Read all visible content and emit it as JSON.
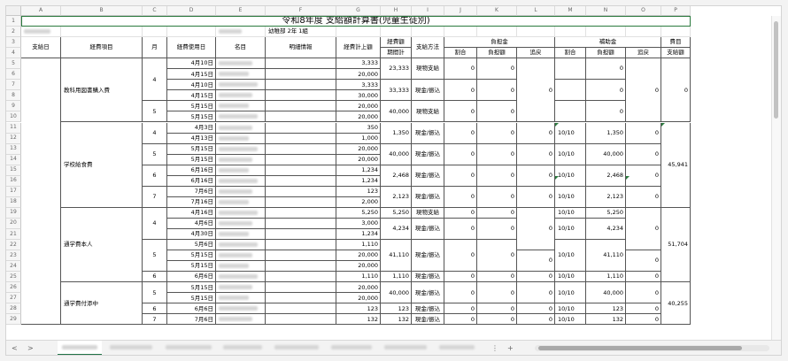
{
  "sheet": {
    "title": "令和8年度 支給額計算書(児童生徒別)",
    "school_label": "幼稚部 2年 1組",
    "columns": [
      "A",
      "B",
      "C",
      "D",
      "E",
      "F",
      "G",
      "H",
      "I",
      "J",
      "K",
      "L",
      "M",
      "N",
      "O",
      "P"
    ],
    "row_numbers": [
      "1",
      "2",
      "3",
      "4",
      "5",
      "6",
      "7",
      "8",
      "9",
      "10",
      "11",
      "12",
      "13",
      "14",
      "15",
      "16",
      "17",
      "18",
      "19",
      "20",
      "21",
      "22",
      "23",
      "24",
      "25",
      "26",
      "27",
      "28",
      "29"
    ],
    "headers": {
      "pay_date": "支給日",
      "expense_item": "経費項目",
      "month": "月",
      "usage_date": "経費使用日",
      "name": "名目",
      "detail": "明細情報",
      "expense_amount": "経費計上額",
      "period_total_1": "経費額",
      "period_total_2": "期間計",
      "pay_method": "支給方法",
      "burden": "負担金",
      "subsidy": "補助金",
      "ratio": "割合",
      "burden_amount": "負担額",
      "refund": "追戻",
      "item_pay_1": "費目",
      "item_pay_2": "支給額"
    },
    "items": {
      "textbooks": "教科用図書購入費",
      "lunch": "学校給食費",
      "commute_self": "通学費本人",
      "commute_escort": "通学費付添中"
    },
    "rows": {
      "r5": {
        "month": "",
        "date": "4月10日",
        "amt": "3,333",
        "period": "23,333",
        "method": "現物支給",
        "j": "0",
        "k": "0",
        "l": "",
        "m": "",
        "n": "0",
        "o": "0"
      },
      "r6": {
        "date": "4月15日",
        "amt": "20,000"
      },
      "r7": {
        "date": "4月10日",
        "amt": "3,333",
        "period": "33,333",
        "method": "現金/振込",
        "j": "0",
        "k": "0",
        "m": "",
        "n": "0",
        "o": "0"
      },
      "r8": {
        "date": "4月15日",
        "amt": "30,000"
      },
      "r9": {
        "date": "5月15日",
        "amt": "20,000",
        "period": "40,000",
        "method": "現物支給",
        "j": "0",
        "k": "0",
        "m": "",
        "n": "0",
        "o": "0"
      },
      "r10": {
        "date": "5月15日",
        "amt": "20,000"
      },
      "r11": {
        "date": "4月3日",
        "amt": "350",
        "period": "1,350",
        "method": "現金/振込",
        "j": "0",
        "k": "0",
        "l": "0",
        "m": "10/10",
        "n": "1,350",
        "o": "0"
      },
      "r12": {
        "date": "4月13日",
        "amt": "1,000"
      },
      "r13": {
        "date": "5月15日",
        "amt": "20,000",
        "period": "40,000",
        "method": "現金/振込",
        "j": "0",
        "k": "0",
        "l": "0",
        "m": "10/10",
        "n": "40,000",
        "o": "0"
      },
      "r14": {
        "date": "5月15日",
        "amt": "20,000"
      },
      "r15": {
        "date": "6月16日",
        "amt": "1,234",
        "period": "2,468",
        "method": "現金/振込",
        "j": "0",
        "k": "0",
        "l": "0",
        "m": "10/10",
        "n": "2,468",
        "o": "0"
      },
      "r16": {
        "date": "6月16日",
        "amt": "1,234"
      },
      "r17": {
        "date": "7月6日",
        "amt": "123",
        "period": "2,123",
        "method": "現金/振込",
        "j": "0",
        "k": "0",
        "l": "0",
        "m": "10/10",
        "n": "2,123",
        "o": "0"
      },
      "r18": {
        "date": "7月16日",
        "amt": "2,000"
      },
      "r19": {
        "date": "4月16日",
        "amt": "5,250",
        "period": "5,250",
        "method": "現物支給",
        "j": "0",
        "k": "0",
        "m": "10/10",
        "n": "5,250"
      },
      "r20": {
        "date": "4月6日",
        "amt": "3,000",
        "period": "4,234",
        "method": "現金/振込",
        "j": "0",
        "k": "0",
        "m": "10/10",
        "n": "4,234"
      },
      "r21": {
        "date": "4月30日",
        "amt": "1,234"
      },
      "r22": {
        "date": "5月6日",
        "amt": "1,110"
      },
      "r23": {
        "date": "5月15日",
        "amt": "20,000",
        "period": "41,110",
        "method": "現金/振込",
        "j": "0",
        "k": "0",
        "l": "0",
        "m": "10/10",
        "n": "41,110",
        "o": "0"
      },
      "r24": {
        "date": "5月15日",
        "amt": "20,000"
      },
      "r25": {
        "date": "6月6日",
        "amt": "1,110",
        "period": "1,110",
        "method": "現金/振込",
        "j": "0",
        "k": "0",
        "l": "0",
        "m": "10/10",
        "n": "1,110",
        "o": "0"
      },
      "r26": {
        "date": "5月15日",
        "amt": "20,000",
        "period": "40,000",
        "method": "現金/振込",
        "j": "0",
        "k": "0",
        "m": "10/10",
        "n": "40,000",
        "o": "0"
      },
      "r27": {
        "date": "5月15日",
        "amt": "20,000"
      },
      "r28": {
        "date": "6月6日",
        "amt": "123",
        "period": "123",
        "method": "現金/振込",
        "j": "0",
        "k": "0",
        "l": "0",
        "m": "10/10",
        "n": "123",
        "o": "0"
      },
      "r29": {
        "date": "7月6日",
        "amt": "132",
        "period": "132",
        "method": "現金/振込",
        "j": "0",
        "k": "0",
        "l": "0",
        "m": "10/10",
        "n": "132",
        "o": "0"
      }
    },
    "months": {
      "m4a": "4",
      "m5a": "5",
      "m4b": "4",
      "m5b": "5",
      "m6b": "6",
      "m7b": "7",
      "m4c": "4",
      "m5c": "5",
      "m6c": "6",
      "m5d": "5",
      "m6d": "6",
      "m7d": "7"
    },
    "merged": {
      "l5_8": "0",
      "o5_8": "0",
      "p_tb": "0",
      "p_lunch": "45,941",
      "l19_22": "0",
      "o19_22": "0",
      "p_commute": "51,704",
      "l26_27": "0",
      "p_escort": "40,255"
    }
  },
  "footer": {
    "nav_prev": "<",
    "nav_next": ">",
    "add_sheet": "+",
    "more": "⋮"
  },
  "colors": {
    "accent": "#217346",
    "title_border": "#2b7a3e"
  }
}
